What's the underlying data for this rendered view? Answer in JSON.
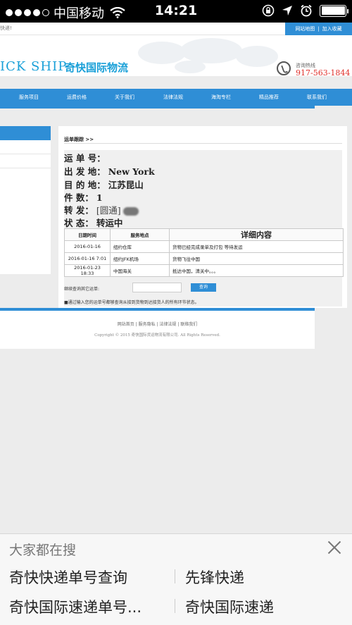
{
  "statusbar": {
    "carrier": "中国移动",
    "time": "14:21"
  },
  "site": {
    "top_left": "快递!",
    "top_links": [
      "网站地图",
      "|",
      "加入收藏"
    ],
    "logo_en": "ICK SHIP",
    "logo_cn": "奇快国际物流",
    "hotline_label": "咨询热线",
    "hotline_number": "917-563-1844",
    "nav": [
      "服务项目",
      "运费价格",
      "关于我们",
      "法律法规",
      "海淘专栏",
      "精品推荐",
      "联系我们"
    ]
  },
  "tracking": {
    "breadcrumb": "运单跟踪 >>",
    "fields": [
      {
        "label": "运 单 号：",
        "value": ""
      },
      {
        "label": "出 发 地：",
        "value": "New York"
      },
      {
        "label": "目 的 地：",
        "value": "江苏昆山"
      },
      {
        "label": "件    数：",
        "value": "1"
      },
      {
        "label": "转    发：",
        "value": "[圆通]"
      },
      {
        "label": "状    态：",
        "value": "转运中"
      }
    ],
    "columns": [
      "日期时间",
      "服务地点",
      "详细内容"
    ],
    "rows": [
      {
        "time": "2016-01-16",
        "place": "纽约仓库",
        "detail": "货物已经完成录单及打包 等待发运"
      },
      {
        "time": "2016-01-16 7:01",
        "place": "纽约JFK机场",
        "detail": "货物飞往中国"
      },
      {
        "time": "2016-01-23 18:33",
        "place": "中国海关",
        "detail": "抵达中国，清关中。。。"
      }
    ],
    "query_label": "继续查询其它运单:",
    "query_button": "查询",
    "note": "■通过输入您的运单号都够查询从接到货物到达接货人的所有环节状态。"
  },
  "footer": {
    "links": "网站首页 | 服务隐私 | 法律法规 | 联络我们",
    "copyright": "Copyright © 2015 奇快国际货运物流有限公司. All Rights Reserved."
  },
  "suggest": {
    "title": "大家都在搜",
    "items": [
      "奇快快递单号查询",
      "先锋快递",
      "奇快国际速递单号...",
      "奇快国际速递"
    ]
  },
  "colors": {
    "brand_blue": "#2f8ed6",
    "logo_cyan": "#1aa0d8",
    "hotline_red": "#e0302b"
  }
}
